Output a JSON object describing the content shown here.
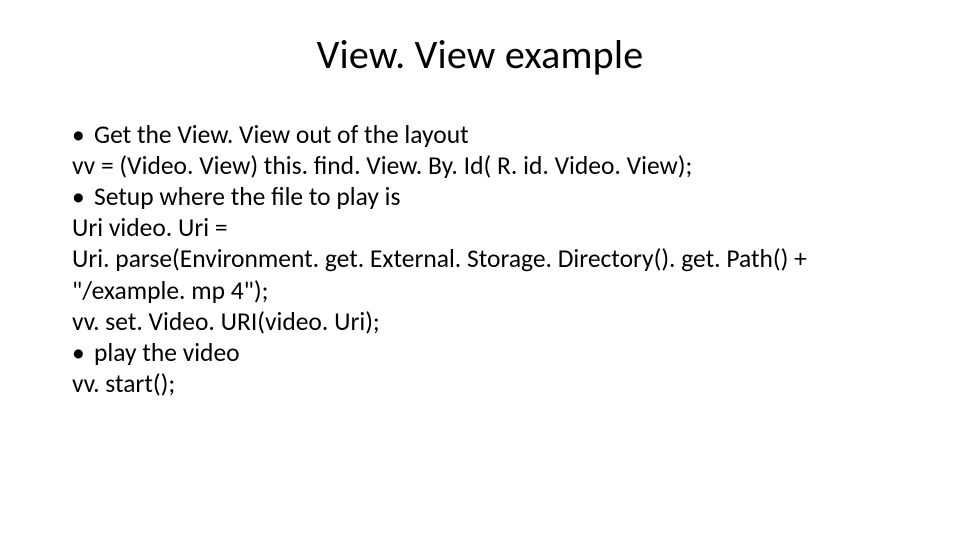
{
  "slide": {
    "title": "View. View example",
    "lines": {
      "b1": "Get the View. View out of the layout",
      "l1": "vv = (Video. View) this. find. View. By. Id( R. id. Video. View);",
      "b2": "Setup where the file to play is",
      "l2": "Uri video. Uri =",
      "l3": "Uri. parse(Environment. get. External. Storage. Directory(). get. Path() + \"/example. mp 4\");",
      "l4": "vv. set. Video. URI(video. Uri);",
      "b3": "play the video",
      "l5": "vv. start();"
    }
  }
}
